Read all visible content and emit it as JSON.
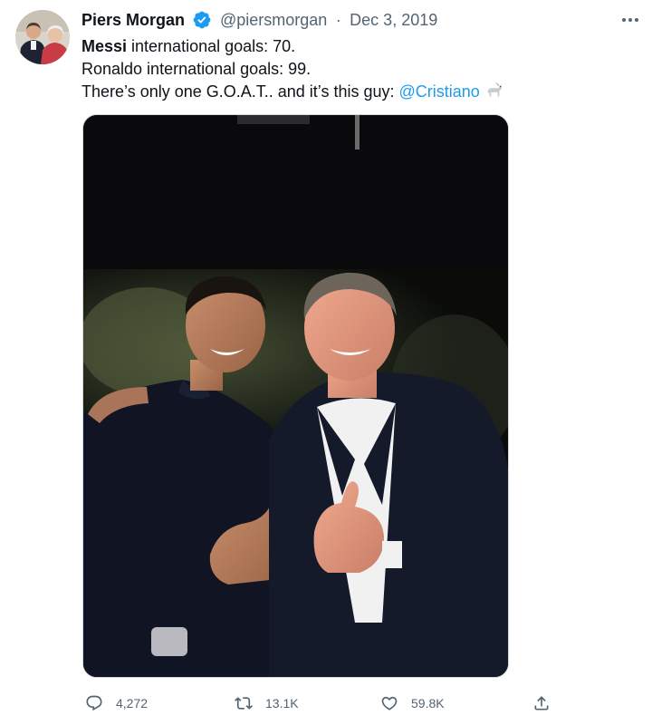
{
  "tweet": {
    "author_name": "Piers Morgan",
    "handle": "@piersmorgan",
    "separator": "·",
    "date": "Dec 3, 2019",
    "line1_bold": "Messi",
    "line1_rest": " international goals: 70.",
    "line2": "Ronaldo international goals: 99.",
    "line3": "There’s only one G.O.A.T.. and it’s this guy: ",
    "mention": "@Cristiano",
    "emoji": "goat-emoji"
  },
  "metrics": {
    "replies": "4,272",
    "retweets": "13.1K",
    "likes": "59.8K"
  },
  "icons": [
    "verified-badge-icon",
    "more-icon",
    "reply-icon",
    "retweet-icon",
    "like-icon",
    "share-icon"
  ],
  "colors": {
    "link": "#1d9bf0",
    "verified": "#1d9bf0",
    "secondary_text": "#536471",
    "primary_text": "#0f1419"
  }
}
